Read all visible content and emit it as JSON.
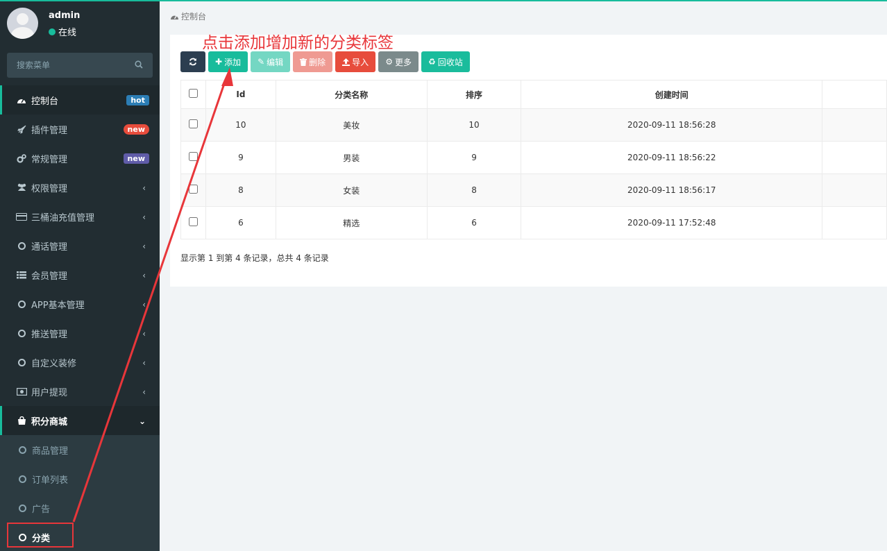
{
  "user": {
    "name": "admin",
    "status": "在线"
  },
  "search": {
    "placeholder": "搜索菜单"
  },
  "menu": [
    {
      "label": "控制台",
      "icon": "dashboard-icon",
      "badge": "hot"
    },
    {
      "label": "插件管理",
      "icon": "rocket-icon",
      "badge": "new"
    },
    {
      "label": "常规管理",
      "icon": "cogs-icon",
      "badge": "new"
    },
    {
      "label": "权限管理",
      "icon": "users-icon",
      "chevron": "‹"
    },
    {
      "label": "三桶油充值管理",
      "icon": "credit-card-icon",
      "chevron": "‹"
    },
    {
      "label": "通话管理",
      "icon": "circle-icon",
      "chevron": "‹"
    },
    {
      "label": "会员管理",
      "icon": "list-icon",
      "chevron": "‹"
    },
    {
      "label": "APP基本管理",
      "icon": "circle-icon",
      "chevron": "‹"
    },
    {
      "label": "推送管理",
      "icon": "circle-icon",
      "chevron": "‹"
    },
    {
      "label": "自定义装修",
      "icon": "circle-icon",
      "chevron": "‹"
    },
    {
      "label": "用户提现",
      "icon": "money-icon",
      "chevron": "‹"
    },
    {
      "label": "积分商城",
      "icon": "shopping-bag-icon",
      "chevron": "⌄"
    }
  ],
  "submenu": [
    {
      "label": "商品管理"
    },
    {
      "label": "订单列表"
    },
    {
      "label": "广告"
    },
    {
      "label": "分类"
    }
  ],
  "breadcrumb": {
    "label": "控制台"
  },
  "annotation": {
    "text": "点击添加增加新的分类标签"
  },
  "toolbar": {
    "add": "添加",
    "edit": "编辑",
    "delete": "删除",
    "import": "导入",
    "more": "更多",
    "recycle": "回收站"
  },
  "table": {
    "headers": [
      "Id",
      "分类名称",
      "排序",
      "创建时间"
    ],
    "rows": [
      {
        "id": "10",
        "name": "美妆",
        "sort": "10",
        "time": "2020-09-11 18:56:28"
      },
      {
        "id": "9",
        "name": "男装",
        "sort": "9",
        "time": "2020-09-11 18:56:22"
      },
      {
        "id": "8",
        "name": "女装",
        "sort": "8",
        "time": "2020-09-11 18:56:17"
      },
      {
        "id": "6",
        "name": "精选",
        "sort": "6",
        "time": "2020-09-11 17:52:48"
      }
    ]
  },
  "summary": "显示第 1 到第 4 条记录，总共 4 条记录",
  "colors": {
    "accent": "#18bc9c",
    "sidebar": "#222d32",
    "annotation": "#e8363a"
  }
}
